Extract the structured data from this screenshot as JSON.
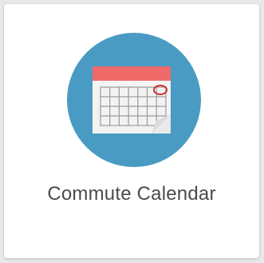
{
  "tile": {
    "title": "Commute Calendar",
    "icon": "calendar-icon"
  },
  "colors": {
    "circle": "#4a9bc3",
    "calendar_header": "#ef6a68",
    "calendar_body": "#f3f3f3",
    "grid": "#9a9a9a",
    "mark": "#d0302d",
    "text": "#4a4a4a"
  }
}
